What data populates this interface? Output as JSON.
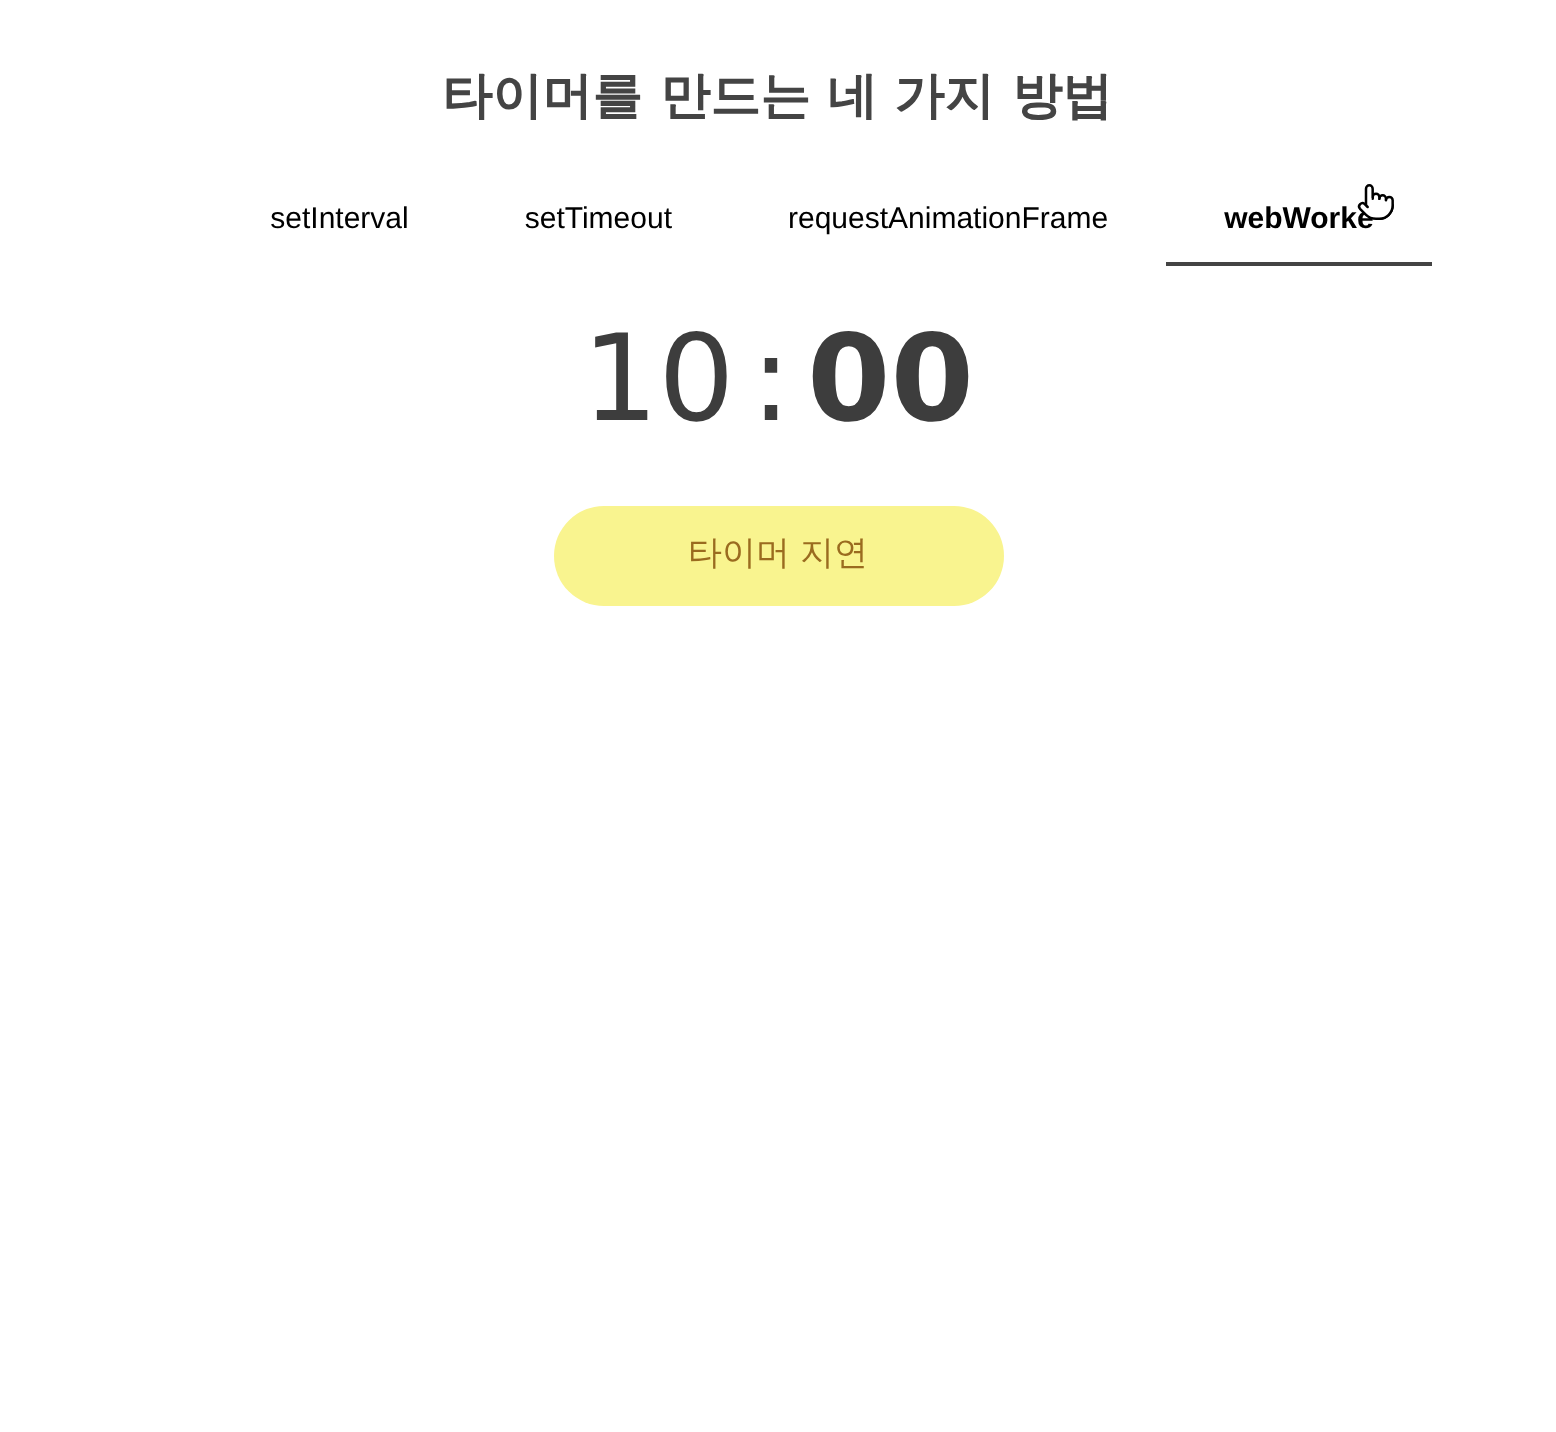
{
  "title": "타이머를 만드는 네 가지 방법",
  "tabs": [
    {
      "label": "setInterval",
      "selected": false
    },
    {
      "label": "setTimeout",
      "selected": false
    },
    {
      "label": "requestAnimationFrame",
      "selected": false
    },
    {
      "label": "webWorke",
      "selected": true
    }
  ],
  "timer": {
    "minutes": "10",
    "separator": ":",
    "seconds": "00"
  },
  "button": {
    "label": "타이머 지연"
  }
}
